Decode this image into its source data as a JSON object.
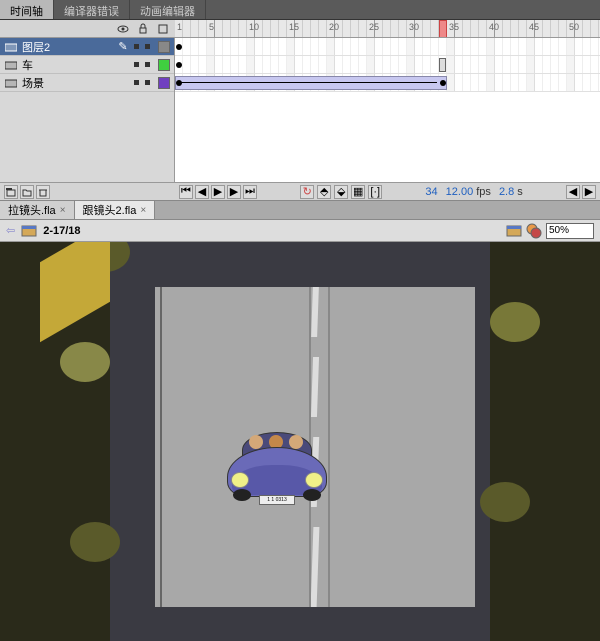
{
  "tabs": {
    "timeline": "时间轴",
    "compiler": "编译器错误",
    "animeditor": "动画编辑器"
  },
  "layers": [
    {
      "name": "图层2",
      "color": "#888888",
      "selected": true
    },
    {
      "name": "车",
      "color": "#40d040",
      "selected": false
    },
    {
      "name": "场景",
      "color": "#7040c0",
      "selected": false
    }
  ],
  "ruler_marks": [
    1,
    5,
    10,
    15,
    20,
    25,
    30,
    35,
    40,
    45,
    50
  ],
  "playhead_frame": 34,
  "footer": {
    "frame": "34",
    "fps": "12.00",
    "fps_label": "fps",
    "time": "2.8",
    "time_unit": "s"
  },
  "files": [
    {
      "name": "拉镜头.fla",
      "active": false
    },
    {
      "name": "跟镜头2.fla",
      "active": true
    }
  ],
  "scene": {
    "label": "2-17/18",
    "zoom": "50%"
  },
  "car_plate": "1 1 0313"
}
